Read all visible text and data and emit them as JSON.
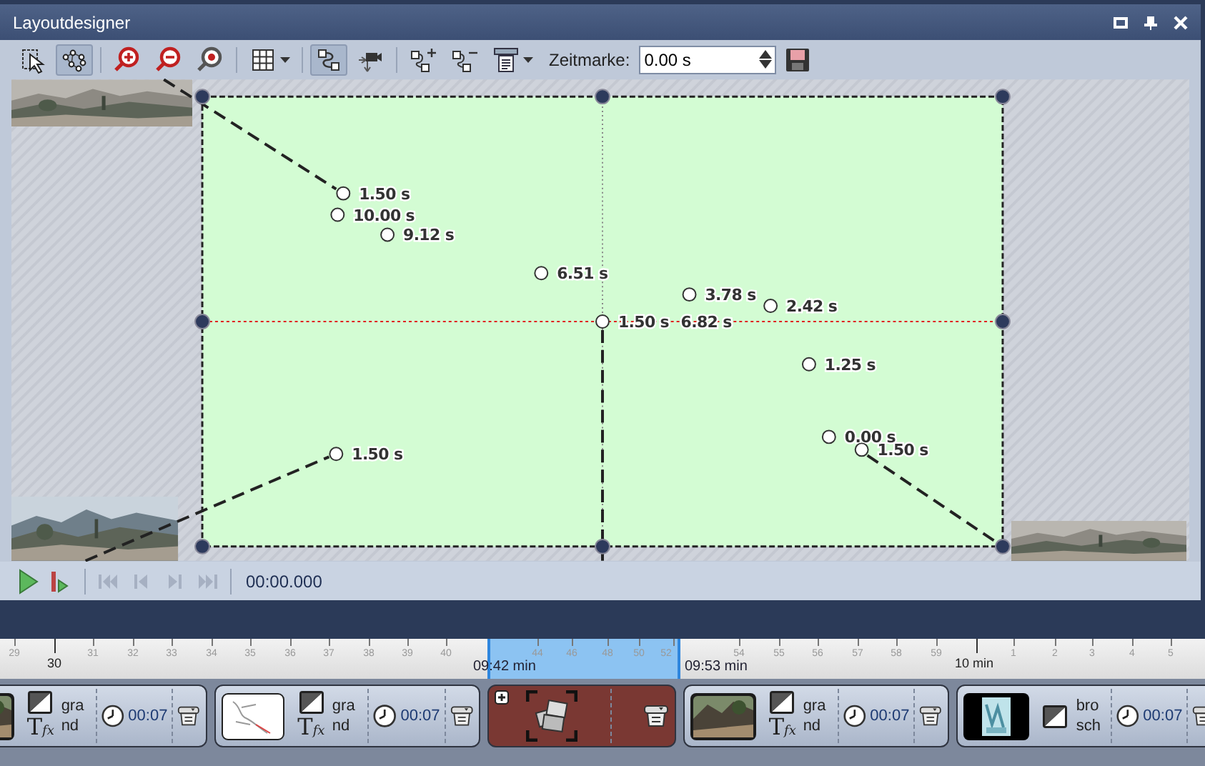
{
  "window": {
    "title": "Layoutdesigner",
    "controls": [
      {
        "kind": "restore"
      },
      {
        "kind": "pin"
      },
      {
        "kind": "close"
      }
    ]
  },
  "toolbar": {
    "groups": [
      [
        {
          "kind": "select",
          "selected": false
        },
        {
          "kind": "nodes",
          "selected": true
        }
      ],
      [
        {
          "kind": "zoom-in",
          "selected": false
        },
        {
          "kind": "zoom-out",
          "selected": false
        },
        {
          "kind": "zoom-fit",
          "selected": false
        }
      ],
      [
        {
          "kind": "grid",
          "selected": false
        }
      ],
      [
        {
          "kind": "path",
          "selected": true
        },
        {
          "kind": "camera",
          "selected": false
        }
      ],
      [
        {
          "kind": "add-node",
          "selected": false
        },
        {
          "kind": "remove-node",
          "selected": false
        },
        {
          "kind": "align",
          "selected": false
        }
      ]
    ],
    "time_label": "Zeitmarke:",
    "time_value": "0.00 s"
  },
  "canvas": {
    "keyframes": [
      {
        "label": "1.50 s"
      },
      {
        "label": "10.00 s"
      },
      {
        "label": "9.12 s"
      },
      {
        "label": "6.51 s"
      },
      {
        "label": "3.78 s"
      },
      {
        "label": "2.42 s"
      },
      {
        "label": "1.50 s"
      },
      {
        "label": "6.82 s"
      },
      {
        "label": "1.25 s"
      },
      {
        "label": "0.00 s"
      },
      {
        "label": "1.50 s"
      },
      {
        "label": "1.50 s"
      }
    ]
  },
  "playback": {
    "controls": [
      {
        "kind": "play",
        "disabled": false
      },
      {
        "kind": "play-from",
        "disabled": false
      },
      {
        "kind": "first",
        "disabled": true
      },
      {
        "kind": "previous",
        "disabled": true
      },
      {
        "kind": "next",
        "disabled": true
      },
      {
        "kind": "last",
        "disabled": true
      }
    ],
    "time": "00:00.000"
  },
  "timeline": {
    "ticks": [
      {
        "label": "29",
        "major": false
      },
      {
        "label": "30",
        "major": true
      },
      {
        "label": "31",
        "major": false
      },
      {
        "label": "32",
        "major": false
      },
      {
        "label": "33",
        "major": false
      },
      {
        "label": "34",
        "major": false
      },
      {
        "label": "35",
        "major": false
      },
      {
        "label": "36",
        "major": false
      },
      {
        "label": "37",
        "major": false
      },
      {
        "label": "38",
        "major": false
      },
      {
        "label": "39",
        "major": false
      },
      {
        "label": "40",
        "major": false
      },
      {
        "label": "44",
        "major": false
      },
      {
        "label": "46",
        "major": false
      },
      {
        "label": "48",
        "major": false
      },
      {
        "label": "50",
        "major": false
      },
      {
        "label": "52",
        "major": false
      },
      {
        "label": "54",
        "major": false
      },
      {
        "label": "55",
        "major": false
      },
      {
        "label": "56",
        "major": false
      },
      {
        "label": "57",
        "major": false
      },
      {
        "label": "58",
        "major": false
      },
      {
        "label": "59",
        "major": false
      },
      {
        "label": "10 min",
        "major": true
      },
      {
        "label": "1",
        "major": false
      },
      {
        "label": "2",
        "major": false
      },
      {
        "label": "3",
        "major": false
      },
      {
        "label": "4",
        "major": false
      },
      {
        "label": "5",
        "major": false
      }
    ],
    "selection_start": "09:42 min",
    "selection_end": "09:53 min"
  },
  "clips": [
    {
      "title_lines": [
        "gra",
        "nd"
      ],
      "effect": {
        "glyph": "T",
        "sub": "fx"
      },
      "duration": "00:07"
    },
    {
      "title_lines": [
        "gra",
        "nd"
      ],
      "effect": {
        "glyph": "T",
        "sub": "fx"
      },
      "duration": "00:07"
    },
    {
      "kind": "collage"
    },
    {
      "title_lines": [
        "gra",
        "nd"
      ],
      "effect": {
        "glyph": "T",
        "sub": "fx"
      },
      "duration": "00:07"
    },
    {
      "title_lines": [
        "bro",
        "sch"
      ],
      "duration": "00:07"
    }
  ]
}
